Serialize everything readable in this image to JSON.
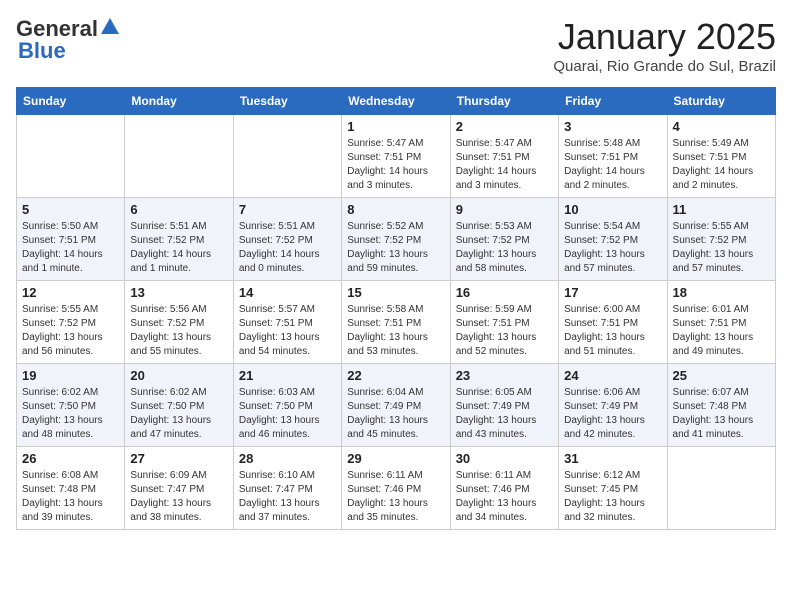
{
  "header": {
    "logo_general": "General",
    "logo_blue": "Blue",
    "title": "January 2025",
    "subtitle": "Quarai, Rio Grande do Sul, Brazil"
  },
  "weekdays": [
    "Sunday",
    "Monday",
    "Tuesday",
    "Wednesday",
    "Thursday",
    "Friday",
    "Saturday"
  ],
  "weeks": [
    [
      {
        "day": "",
        "sunrise": "",
        "sunset": "",
        "daylight": ""
      },
      {
        "day": "",
        "sunrise": "",
        "sunset": "",
        "daylight": ""
      },
      {
        "day": "",
        "sunrise": "",
        "sunset": "",
        "daylight": ""
      },
      {
        "day": "1",
        "sunrise": "Sunrise: 5:47 AM",
        "sunset": "Sunset: 7:51 PM",
        "daylight": "Daylight: 14 hours and 3 minutes."
      },
      {
        "day": "2",
        "sunrise": "Sunrise: 5:47 AM",
        "sunset": "Sunset: 7:51 PM",
        "daylight": "Daylight: 14 hours and 3 minutes."
      },
      {
        "day": "3",
        "sunrise": "Sunrise: 5:48 AM",
        "sunset": "Sunset: 7:51 PM",
        "daylight": "Daylight: 14 hours and 2 minutes."
      },
      {
        "day": "4",
        "sunrise": "Sunrise: 5:49 AM",
        "sunset": "Sunset: 7:51 PM",
        "daylight": "Daylight: 14 hours and 2 minutes."
      }
    ],
    [
      {
        "day": "5",
        "sunrise": "Sunrise: 5:50 AM",
        "sunset": "Sunset: 7:51 PM",
        "daylight": "Daylight: 14 hours and 1 minute."
      },
      {
        "day": "6",
        "sunrise": "Sunrise: 5:51 AM",
        "sunset": "Sunset: 7:52 PM",
        "daylight": "Daylight: 14 hours and 1 minute."
      },
      {
        "day": "7",
        "sunrise": "Sunrise: 5:51 AM",
        "sunset": "Sunset: 7:52 PM",
        "daylight": "Daylight: 14 hours and 0 minutes."
      },
      {
        "day": "8",
        "sunrise": "Sunrise: 5:52 AM",
        "sunset": "Sunset: 7:52 PM",
        "daylight": "Daylight: 13 hours and 59 minutes."
      },
      {
        "day": "9",
        "sunrise": "Sunrise: 5:53 AM",
        "sunset": "Sunset: 7:52 PM",
        "daylight": "Daylight: 13 hours and 58 minutes."
      },
      {
        "day": "10",
        "sunrise": "Sunrise: 5:54 AM",
        "sunset": "Sunset: 7:52 PM",
        "daylight": "Daylight: 13 hours and 57 minutes."
      },
      {
        "day": "11",
        "sunrise": "Sunrise: 5:55 AM",
        "sunset": "Sunset: 7:52 PM",
        "daylight": "Daylight: 13 hours and 57 minutes."
      }
    ],
    [
      {
        "day": "12",
        "sunrise": "Sunrise: 5:55 AM",
        "sunset": "Sunset: 7:52 PM",
        "daylight": "Daylight: 13 hours and 56 minutes."
      },
      {
        "day": "13",
        "sunrise": "Sunrise: 5:56 AM",
        "sunset": "Sunset: 7:52 PM",
        "daylight": "Daylight: 13 hours and 55 minutes."
      },
      {
        "day": "14",
        "sunrise": "Sunrise: 5:57 AM",
        "sunset": "Sunset: 7:51 PM",
        "daylight": "Daylight: 13 hours and 54 minutes."
      },
      {
        "day": "15",
        "sunrise": "Sunrise: 5:58 AM",
        "sunset": "Sunset: 7:51 PM",
        "daylight": "Daylight: 13 hours and 53 minutes."
      },
      {
        "day": "16",
        "sunrise": "Sunrise: 5:59 AM",
        "sunset": "Sunset: 7:51 PM",
        "daylight": "Daylight: 13 hours and 52 minutes."
      },
      {
        "day": "17",
        "sunrise": "Sunrise: 6:00 AM",
        "sunset": "Sunset: 7:51 PM",
        "daylight": "Daylight: 13 hours and 51 minutes."
      },
      {
        "day": "18",
        "sunrise": "Sunrise: 6:01 AM",
        "sunset": "Sunset: 7:51 PM",
        "daylight": "Daylight: 13 hours and 49 minutes."
      }
    ],
    [
      {
        "day": "19",
        "sunrise": "Sunrise: 6:02 AM",
        "sunset": "Sunset: 7:50 PM",
        "daylight": "Daylight: 13 hours and 48 minutes."
      },
      {
        "day": "20",
        "sunrise": "Sunrise: 6:02 AM",
        "sunset": "Sunset: 7:50 PM",
        "daylight": "Daylight: 13 hours and 47 minutes."
      },
      {
        "day": "21",
        "sunrise": "Sunrise: 6:03 AM",
        "sunset": "Sunset: 7:50 PM",
        "daylight": "Daylight: 13 hours and 46 minutes."
      },
      {
        "day": "22",
        "sunrise": "Sunrise: 6:04 AM",
        "sunset": "Sunset: 7:49 PM",
        "daylight": "Daylight: 13 hours and 45 minutes."
      },
      {
        "day": "23",
        "sunrise": "Sunrise: 6:05 AM",
        "sunset": "Sunset: 7:49 PM",
        "daylight": "Daylight: 13 hours and 43 minutes."
      },
      {
        "day": "24",
        "sunrise": "Sunrise: 6:06 AM",
        "sunset": "Sunset: 7:49 PM",
        "daylight": "Daylight: 13 hours and 42 minutes."
      },
      {
        "day": "25",
        "sunrise": "Sunrise: 6:07 AM",
        "sunset": "Sunset: 7:48 PM",
        "daylight": "Daylight: 13 hours and 41 minutes."
      }
    ],
    [
      {
        "day": "26",
        "sunrise": "Sunrise: 6:08 AM",
        "sunset": "Sunset: 7:48 PM",
        "daylight": "Daylight: 13 hours and 39 minutes."
      },
      {
        "day": "27",
        "sunrise": "Sunrise: 6:09 AM",
        "sunset": "Sunset: 7:47 PM",
        "daylight": "Daylight: 13 hours and 38 minutes."
      },
      {
        "day": "28",
        "sunrise": "Sunrise: 6:10 AM",
        "sunset": "Sunset: 7:47 PM",
        "daylight": "Daylight: 13 hours and 37 minutes."
      },
      {
        "day": "29",
        "sunrise": "Sunrise: 6:11 AM",
        "sunset": "Sunset: 7:46 PM",
        "daylight": "Daylight: 13 hours and 35 minutes."
      },
      {
        "day": "30",
        "sunrise": "Sunrise: 6:11 AM",
        "sunset": "Sunset: 7:46 PM",
        "daylight": "Daylight: 13 hours and 34 minutes."
      },
      {
        "day": "31",
        "sunrise": "Sunrise: 6:12 AM",
        "sunset": "Sunset: 7:45 PM",
        "daylight": "Daylight: 13 hours and 32 minutes."
      },
      {
        "day": "",
        "sunrise": "",
        "sunset": "",
        "daylight": ""
      }
    ]
  ]
}
